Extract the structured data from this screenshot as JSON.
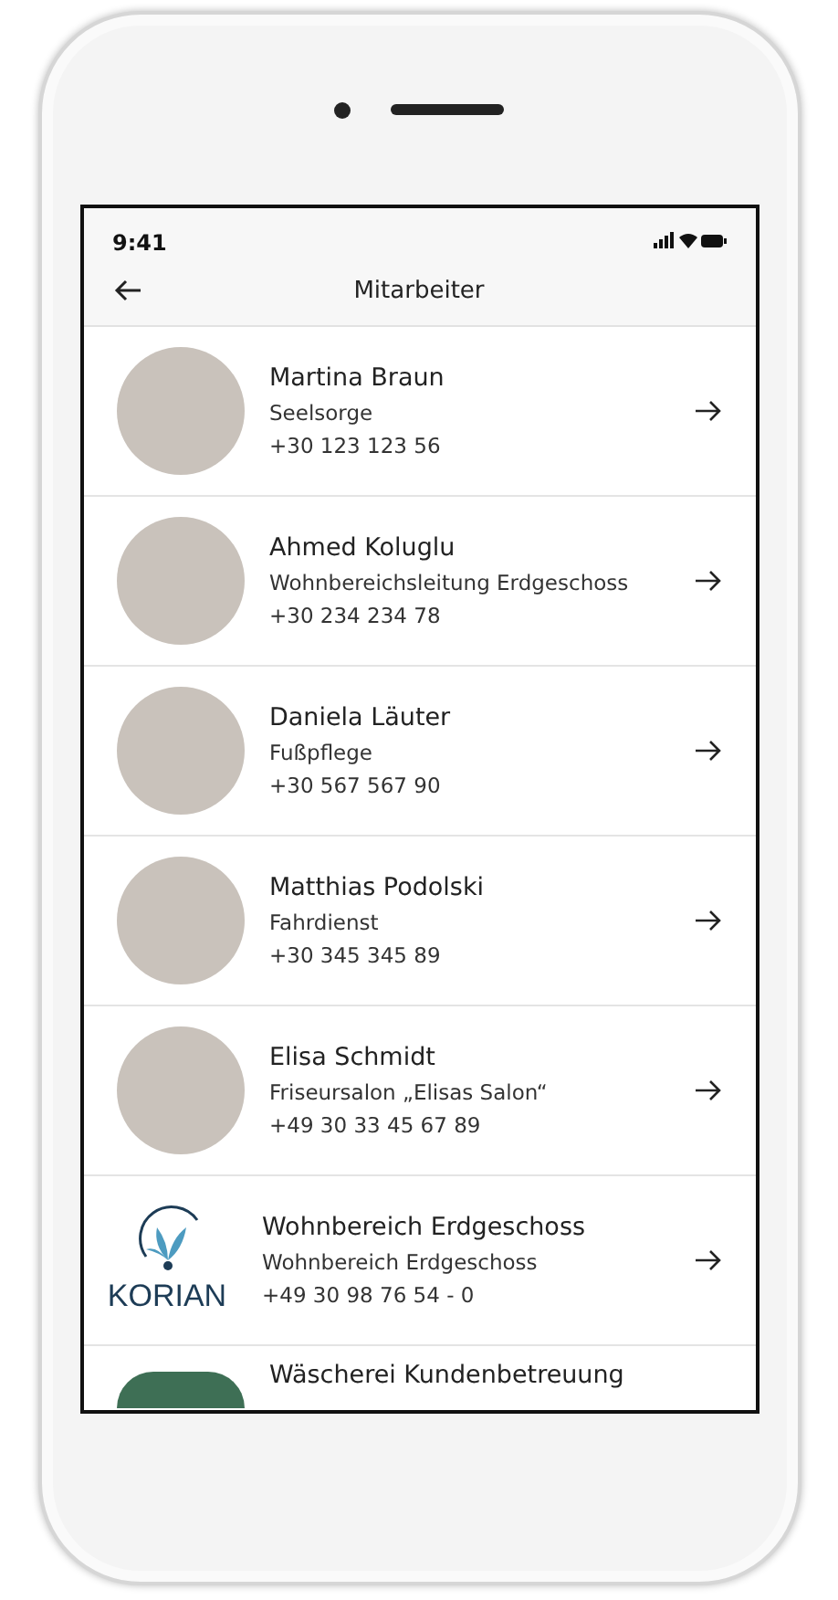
{
  "status_bar": {
    "time": "9:41"
  },
  "header": {
    "title": "Mitarbeiter"
  },
  "contacts": [
    {
      "kind": "photo",
      "name": "Martina Braun",
      "role": "Seelsorge",
      "phone": "+30 123 123 56"
    },
    {
      "kind": "photo",
      "name": "Ahmed Koluglu",
      "role": "Wohnbereichsleitung Erdgeschoss",
      "phone": "+30 234 234 78"
    },
    {
      "kind": "photo",
      "name": "Daniela Läuter",
      "role": "Fußpflege",
      "phone": "+30 567 567 90"
    },
    {
      "kind": "photo",
      "name": "Matthias Podolski",
      "role": "Fahrdienst",
      "phone": "+30 345 345 89"
    },
    {
      "kind": "photo",
      "name": "Elisa Schmidt",
      "role": "Friseursalon „Elisas Salon“",
      "phone": "+49 30 33 45 67 89"
    },
    {
      "kind": "logo",
      "logo_text": "KORIAN",
      "name": "Wohnbereich Erdgeschoss",
      "role": "Wohnbereich Erdgeschoss",
      "phone": "+49 30 98 76 54 - 0"
    },
    {
      "kind": "partial",
      "name": "Wäscherei Kundenbetreuung"
    }
  ]
}
